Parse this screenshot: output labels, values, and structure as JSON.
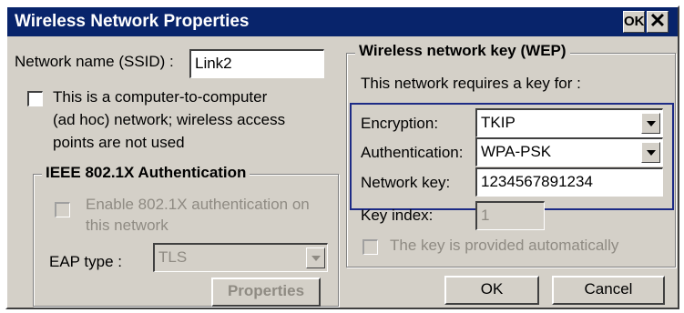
{
  "window": {
    "title": "Wireless Network  Properties",
    "ok_label": "OK",
    "close_glyph": "✕"
  },
  "ssid": {
    "label": "Network name (SSID) :",
    "value": "Link2"
  },
  "adhoc": {
    "checked": false,
    "line1": "This is a computer-to-computer",
    "line2": "(ad hoc) network; wireless access",
    "line3": "points are not used"
  },
  "ieee": {
    "title": "IEEE  802.1X Authentication",
    "enable_line1": "Enable 802.1X authentication on",
    "enable_line2": "this network",
    "enable_checked": false,
    "eap_label": "EAP type :",
    "eap_value": "TLS",
    "properties_label": "Properties"
  },
  "wep": {
    "title": "Wireless network key (WEP)",
    "requires_text": "This network requires a key for :",
    "encryption_label": "Encryption:",
    "encryption_value": "TKIP",
    "authentication_label": "Authentication:",
    "authentication_value": "WPA-PSK",
    "network_key_label": "Network key:",
    "network_key_value": "1234567891234",
    "key_index_label": "Key index:",
    "key_index_value": "1",
    "auto_key_label": "The key is provided automatically",
    "auto_key_checked": false
  },
  "buttons": {
    "ok_label": "OK",
    "cancel_label": "Cancel"
  },
  "colors": {
    "title_bar": "#08246b",
    "dialog_face": "#d4d0c8",
    "highlight_border": "#1d2b86",
    "disabled_text": "#8f8b83"
  }
}
